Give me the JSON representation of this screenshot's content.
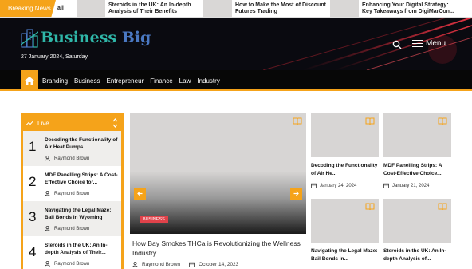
{
  "ticker": {
    "badge": "Breaking News",
    "items": [
      {
        "text": "ail"
      },
      {
        "text": "Steroids in the UK: An In-depth Analysis of Their Benefits"
      },
      {
        "text": "How to Make the Most of Discount Futures Trading"
      },
      {
        "text": "Enhancing Your Digital Strategy: Key Takeaways from DigiMarCon..."
      }
    ]
  },
  "header": {
    "logo_part1": "Business",
    "logo_part2": "Big",
    "date": "27 January 2024, Saturday",
    "menu_label": "Menu",
    "icons": {
      "search": "search-icon",
      "menu": "hamburger-icon"
    }
  },
  "nav": {
    "items": [
      "Branding",
      "Business",
      "Entrepreneur",
      "Finance",
      "Law",
      "Industry"
    ]
  },
  "live": {
    "label": "Live",
    "items": [
      {
        "num": "1",
        "title": "Decoding the Functionality of Air Heat Pumps",
        "author": "Raymond Brown"
      },
      {
        "num": "2",
        "title": "MDF Panelling Strips: A Cost-Effective Choice for...",
        "author": "Raymond Brown"
      },
      {
        "num": "3",
        "title": "Navigating the Legal Maze: Bail Bonds in Wyoming",
        "author": "Raymond Brown"
      },
      {
        "num": "4",
        "title": "Steroids in the UK: An In-depth Analysis of Their...",
        "author": "Raymond Brown"
      }
    ]
  },
  "feature": {
    "category": "BUSINESS",
    "title": "How Bay Smokes THCa is Revolutionizing the Wellness Industry",
    "author": "Raymond Brown",
    "date": "October 14, 2023"
  },
  "cards": [
    {
      "title": "Decoding the Functionality of Air He...",
      "date": "January 24, 2024"
    },
    {
      "title": "MDF Panelling Strips: A Cost-Effective Choice...",
      "date": "January 21, 2024"
    },
    {
      "title": "Navigating the Legal Maze: Bail Bonds in...",
      "date": ""
    },
    {
      "title": "Steroids in the UK: An In-depth Analysis of...",
      "date": ""
    }
  ],
  "colors": {
    "accent": "#f5a31a",
    "badge": "#e0424a",
    "header_bg": "#0a0a10"
  }
}
